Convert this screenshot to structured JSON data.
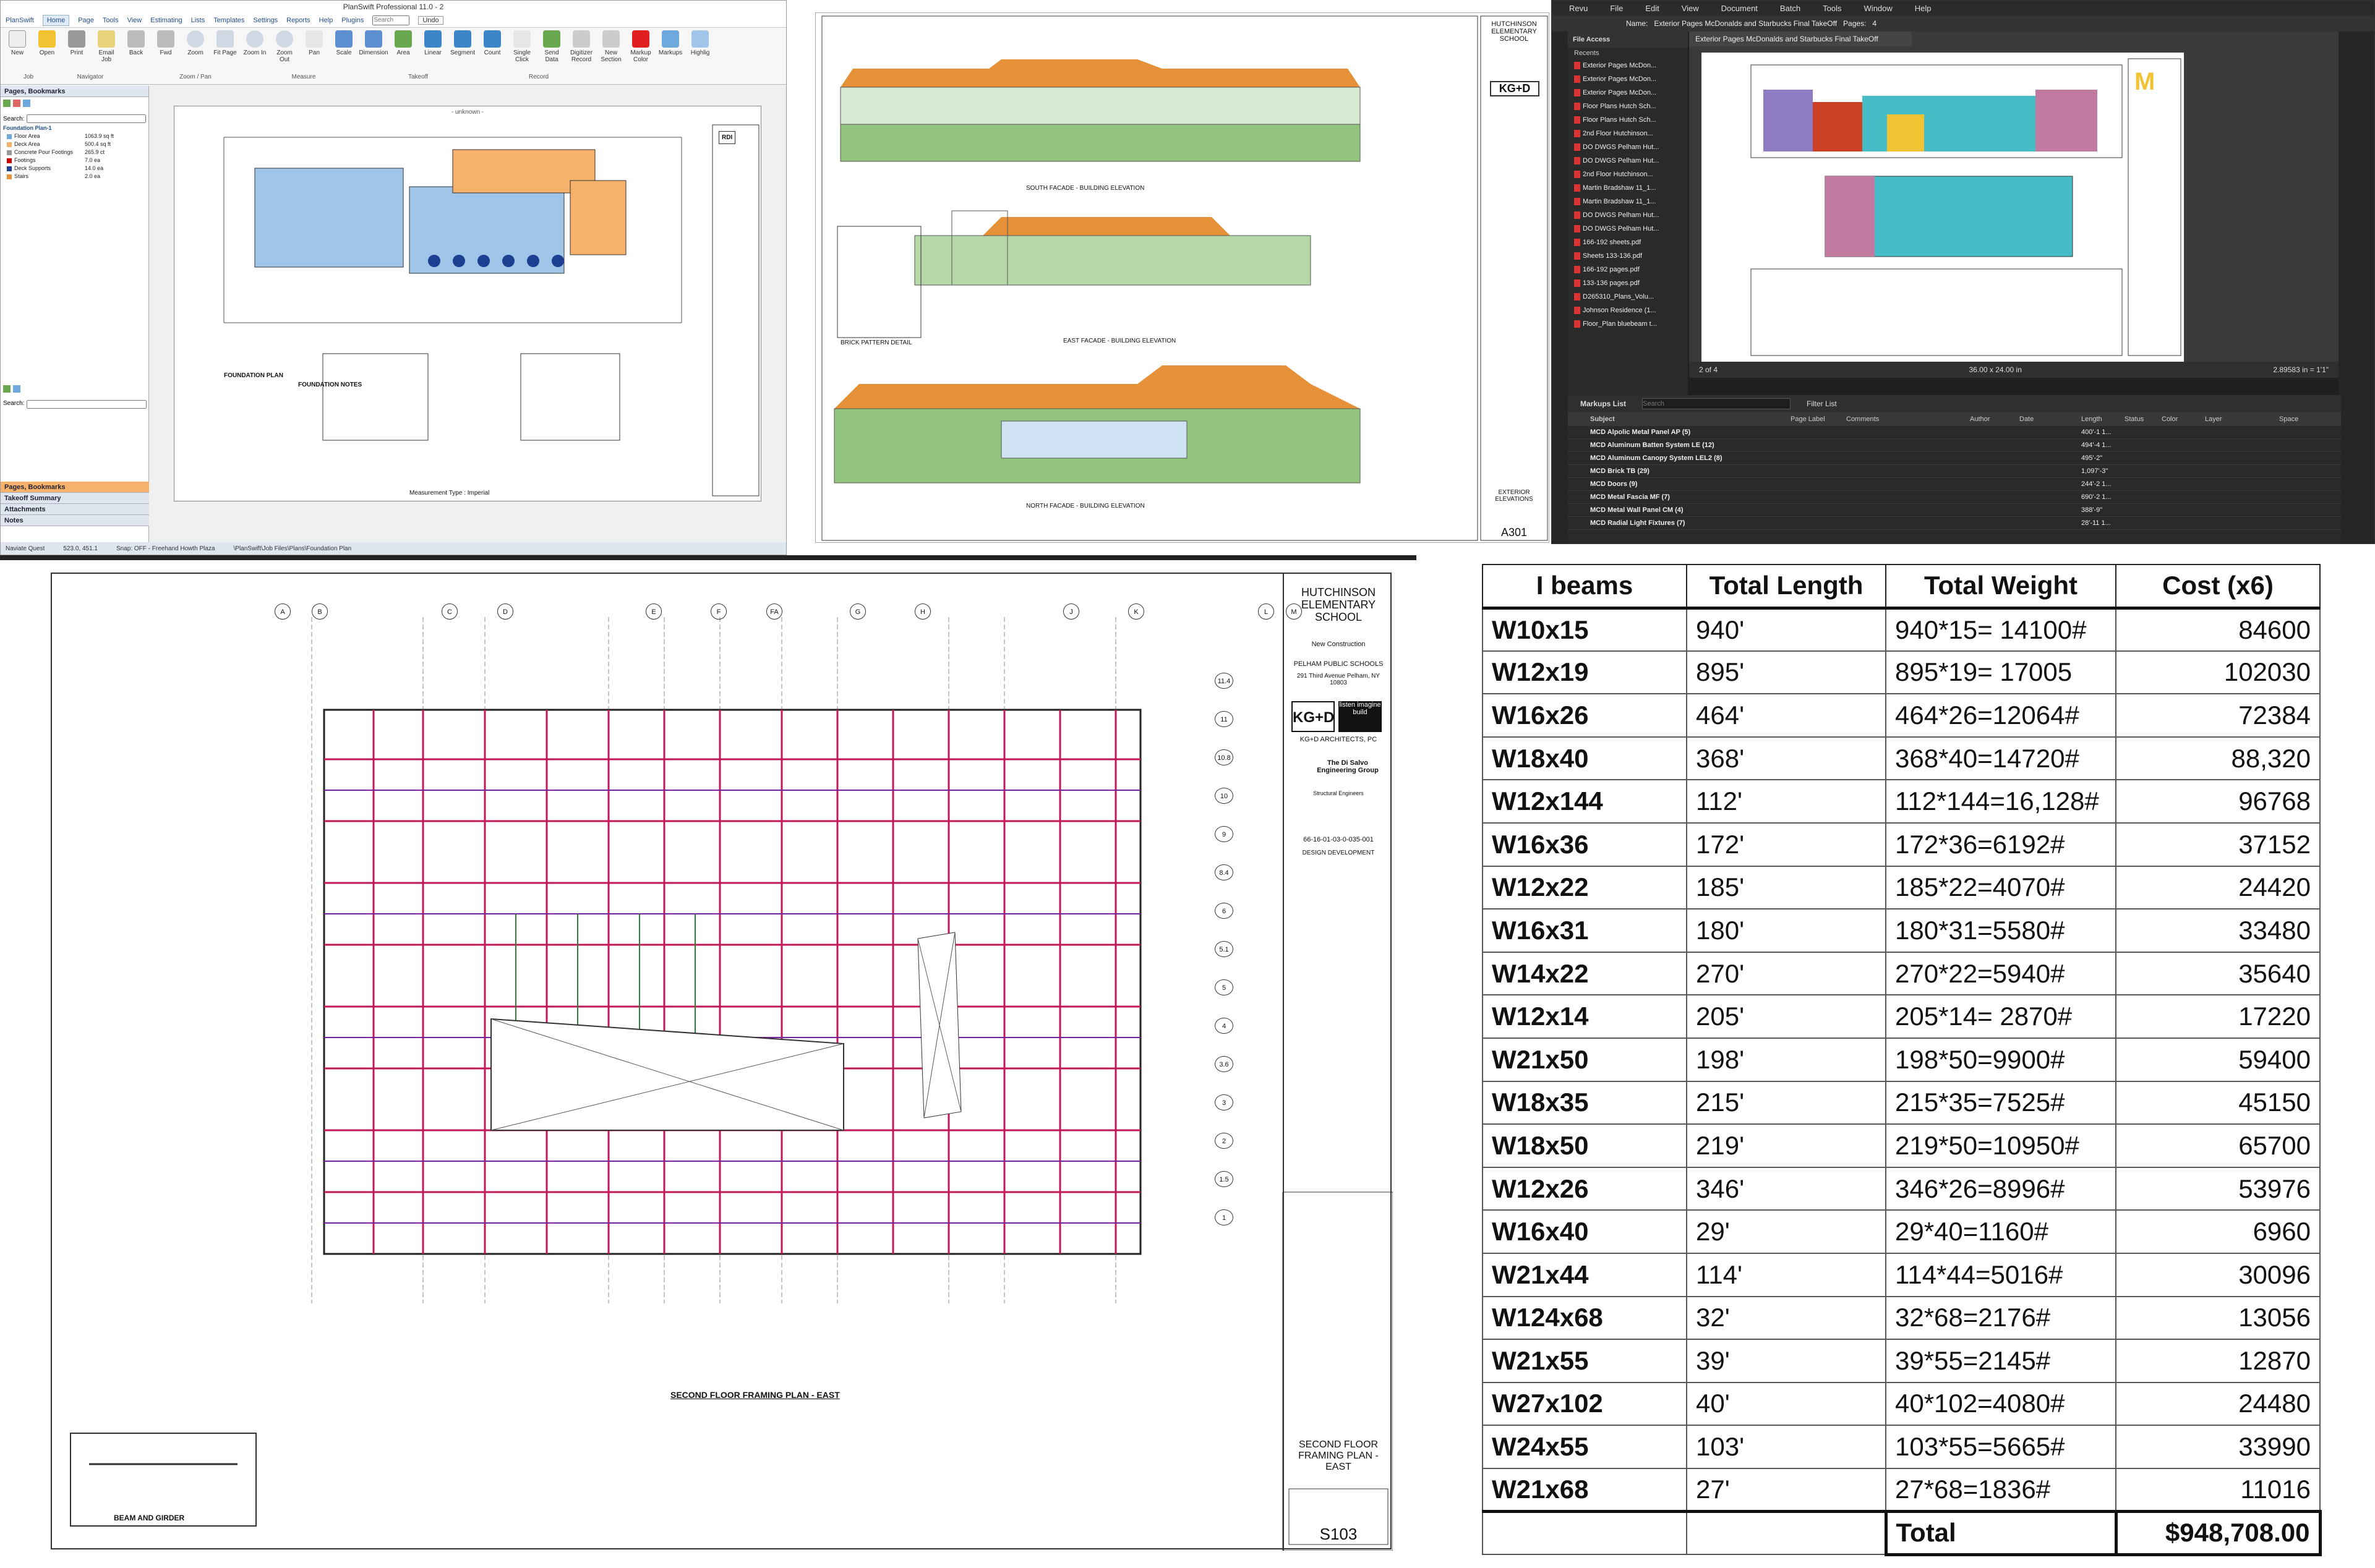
{
  "planswift": {
    "app_title": "PlanSwift Professional 11.0 - 2",
    "menu_tabs": [
      "PlanSwift",
      "Home",
      "Page",
      "Tools",
      "View",
      "Estimating",
      "Lists",
      "Templates",
      "Settings",
      "Reports",
      "Help",
      "Plugins"
    ],
    "search_placeholder": "Search",
    "undo_label": "Undo",
    "ribbon_buttons": [
      "New",
      "Open",
      "Print",
      "Email Job",
      "Back",
      "Fwd",
      "Zoom",
      "Fit Page",
      "Zoom In",
      "Zoom Out",
      "Pan",
      "Scale",
      "Dimension",
      "Area",
      "Linear",
      "Segment",
      "Count",
      "Single Click",
      "Send Data",
      "Digitizer Record",
      "New Section",
      "Markup Color",
      "Markups",
      "Highlig"
    ],
    "ribbon_groups": [
      "Job",
      "Navigator",
      "Zoom / Pan",
      "Measure",
      "Takeoff",
      "Record"
    ],
    "panel_title": "Pages, Bookmarks",
    "search_label": "Search:",
    "tree_root": "Foundation Plan-1",
    "tree_items": [
      {
        "name": "Floor Area",
        "value": "1063.9 sq ft",
        "color": "#6fa8dc"
      },
      {
        "name": "Deck Area",
        "value": "500.4 sq ft",
        "color": "#f6b26b"
      },
      {
        "name": "Concrete Pour Footings",
        "value": "265.9 ct",
        "color": "#999999"
      },
      {
        "name": "Footings",
        "value": "7.0 ea",
        "color": "#cc0000"
      },
      {
        "name": "Deck Supports",
        "value": "14.0 ea",
        "color": "#1c3f94"
      },
      {
        "name": "Stairs",
        "value": "2.0 ea",
        "color": "#e69138"
      }
    ],
    "bottom_tabs": [
      "Pages, Bookmarks",
      "Takeoff Summary",
      "Attachments",
      "Notes"
    ],
    "canvas_caption": "- unknown -",
    "sheet_labels": [
      "FOUNDATION PLAN",
      "FOUNDATION NOTES",
      "RDI"
    ],
    "measurement_type": "Measurement Type : Imperial",
    "status": [
      "Naviate Quest",
      "523.0, 451.1",
      "Snap: OFF - Freehand  Howth Plaza",
      "\\PlanSwift\\Job Files\\Plans\\Foundation Plan"
    ]
  },
  "elevations": {
    "school": "HUTCHINSON ELEMENTARY SCHOOL",
    "elevation_captions": [
      "SOUTH FACADE - BUILDING ELEVATION",
      "EAST FACADE - BUILDING ELEVATION",
      "NORTH FACADE - BUILDING ELEVATION"
    ],
    "detail_caption": "BRICK PATTERN DETAIL",
    "sheet_title": "EXTERIOR ELEVATIONS",
    "sheet_number": "A301",
    "logo": "KG+D"
  },
  "revu": {
    "menu": [
      "Revu",
      "File",
      "Edit",
      "View",
      "Document",
      "Batch",
      "Tools",
      "Window",
      "Help"
    ],
    "name_label": "Name:",
    "name_value": "Exterior Pages McDonalds and Starbucks Final TakeOff",
    "pages_label": "Pages:",
    "pages_value": "4",
    "file_access_title": "File Access",
    "recents_label": "Recents",
    "recents": [
      "Exterior Pages McDon...",
      "Exterior Pages McDon...",
      "Exterior Pages McDon...",
      "Floor Plans Hutch Sch...",
      "Floor Plans Hutch Sch...",
      "2nd Floor Hutchinson...",
      "DO DWGS Pelham Hut...",
      "DO DWGS Pelham Hut...",
      "2nd Floor Hutchinson...",
      "Martin Bradshaw 11_1...",
      "Martin Bradshaw 11_1...",
      "DO DWGS Pelham Hut...",
      "DO DWGS Pelham Hut...",
      "166-192 sheets.pdf",
      "Sheets 133-136.pdf",
      "166-192 pages.pdf",
      "133-136 pages.pdf",
      "D265310_Plans_Volu...",
      "Johnson Residence (1...",
      "Floor_Plan bluebeam t..."
    ],
    "doc_tab": "Exterior Pages McDonalds and Starbucks Final TakeOff",
    "page_indicator": "2 of 4",
    "page_size": "36.00 x 24.00 in",
    "coords": "2.89583 in = 1'1\"",
    "markups_title": "Markups List",
    "markups_search": "Search",
    "filter_label": "Filter List",
    "columns": [
      "Subject",
      "Page Label",
      "Comments",
      "Author",
      "Date",
      "Length",
      "Status",
      "Color",
      "Layer",
      "Space"
    ],
    "rows": [
      {
        "subject": "MCD Alpolic Metal Panel AP (5)",
        "length": "400'-1 1..."
      },
      {
        "subject": "MCD Aluminum Batten System LE (12)",
        "length": "494'-4 1..."
      },
      {
        "subject": "MCD Aluminum Canopy System LEL2 (8)",
        "length": "495'-2\""
      },
      {
        "subject": "MCD Brick TB (29)",
        "length": "1,097'-3\""
      },
      {
        "subject": "MCD Doors (9)",
        "length": "244'-2 1..."
      },
      {
        "subject": "MCD Metal Fascia MF (7)",
        "length": "690'-2 1..."
      },
      {
        "subject": "MCD Metal Wall Panel CM (4)",
        "length": "388'-9\""
      },
      {
        "subject": "MCD Radial Light Fixtures (7)",
        "length": "28'-11 1..."
      }
    ]
  },
  "framing": {
    "school": "HUTCHINSON ELEMENTARY SCHOOL",
    "subtitle": "New Construction",
    "district": "PELHAM PUBLIC SCHOOLS",
    "address": "291 Third Avenue Pelham, NY 10803",
    "architect_logo": "KG+D",
    "architect_tag": "listen imagine build",
    "architect_name": "KG+D ARCHITECTS, PC",
    "engineer": "The Di Salvo Engineering Group",
    "engineer_role": "Structural Engineers",
    "project_no": "66-16-01-03-0-035-001",
    "phase": "DESIGN DEVELOPMENT",
    "plan_title": "SECOND FLOOR FRAMING PLAN - EAST",
    "sheet_title": "SECOND FLOOR FRAMING PLAN - EAST",
    "sheet_number": "S103",
    "detail_title": "BEAM AND GIRDER",
    "grid_cols": [
      "A",
      "B",
      "C",
      "D",
      "E",
      "F",
      "FA",
      "G",
      "H",
      "J",
      "K",
      "L",
      "M"
    ],
    "grid_rows": [
      "11.4",
      "11",
      "10.8",
      "10",
      "9",
      "8.4",
      "6",
      "5.1",
      "5",
      "4",
      "3.6",
      "3",
      "2",
      "1.5",
      "1"
    ]
  },
  "steel_table": {
    "headers": [
      "I beams",
      "Total Length",
      "Total Weight",
      "Cost (x6)"
    ],
    "rows": [
      [
        "W10x15",
        "940'",
        "940*15= 14100#",
        "84600"
      ],
      [
        "W12x19",
        "895'",
        "895*19= 17005",
        "102030"
      ],
      [
        "W16x26",
        "464'",
        "464*26=12064#",
        "72384"
      ],
      [
        "W18x40",
        "368'",
        "368*40=14720#",
        "88,320"
      ],
      [
        "W12x144",
        "112'",
        "112*144=16,128#",
        "96768"
      ],
      [
        "W16x36",
        "172'",
        "172*36=6192#",
        "37152"
      ],
      [
        "W12x22",
        "185'",
        "185*22=4070#",
        "24420"
      ],
      [
        "W16x31",
        "180'",
        "180*31=5580#",
        "33480"
      ],
      [
        "W14x22",
        "270'",
        "270*22=5940#",
        "35640"
      ],
      [
        "W12x14",
        "205'",
        "205*14= 2870#",
        "17220"
      ],
      [
        "W21x50",
        "198'",
        "198*50=9900#",
        "59400"
      ],
      [
        "W18x35",
        "215'",
        "215*35=7525#",
        "45150"
      ],
      [
        "W18x50",
        "219'",
        "219*50=10950#",
        "65700"
      ],
      [
        "W12x26",
        "346'",
        "346*26=8996#",
        "53976"
      ],
      [
        "W16x40",
        "29'",
        "29*40=1160#",
        "6960"
      ],
      [
        "W21x44",
        "114'",
        "114*44=5016#",
        "30096"
      ],
      [
        "W124x68",
        "32'",
        "32*68=2176#",
        "13056"
      ],
      [
        "W21x55",
        "39'",
        "39*55=2145#",
        "12870"
      ],
      [
        "W27x102",
        "40'",
        "40*102=4080#",
        "24480"
      ],
      [
        "W24x55",
        "103'",
        "103*55=5665#",
        "33990"
      ],
      [
        "W21x68",
        "27'",
        "27*68=1836#",
        "11016"
      ]
    ],
    "total_label": "Total",
    "total_value": "$948,708.00"
  }
}
